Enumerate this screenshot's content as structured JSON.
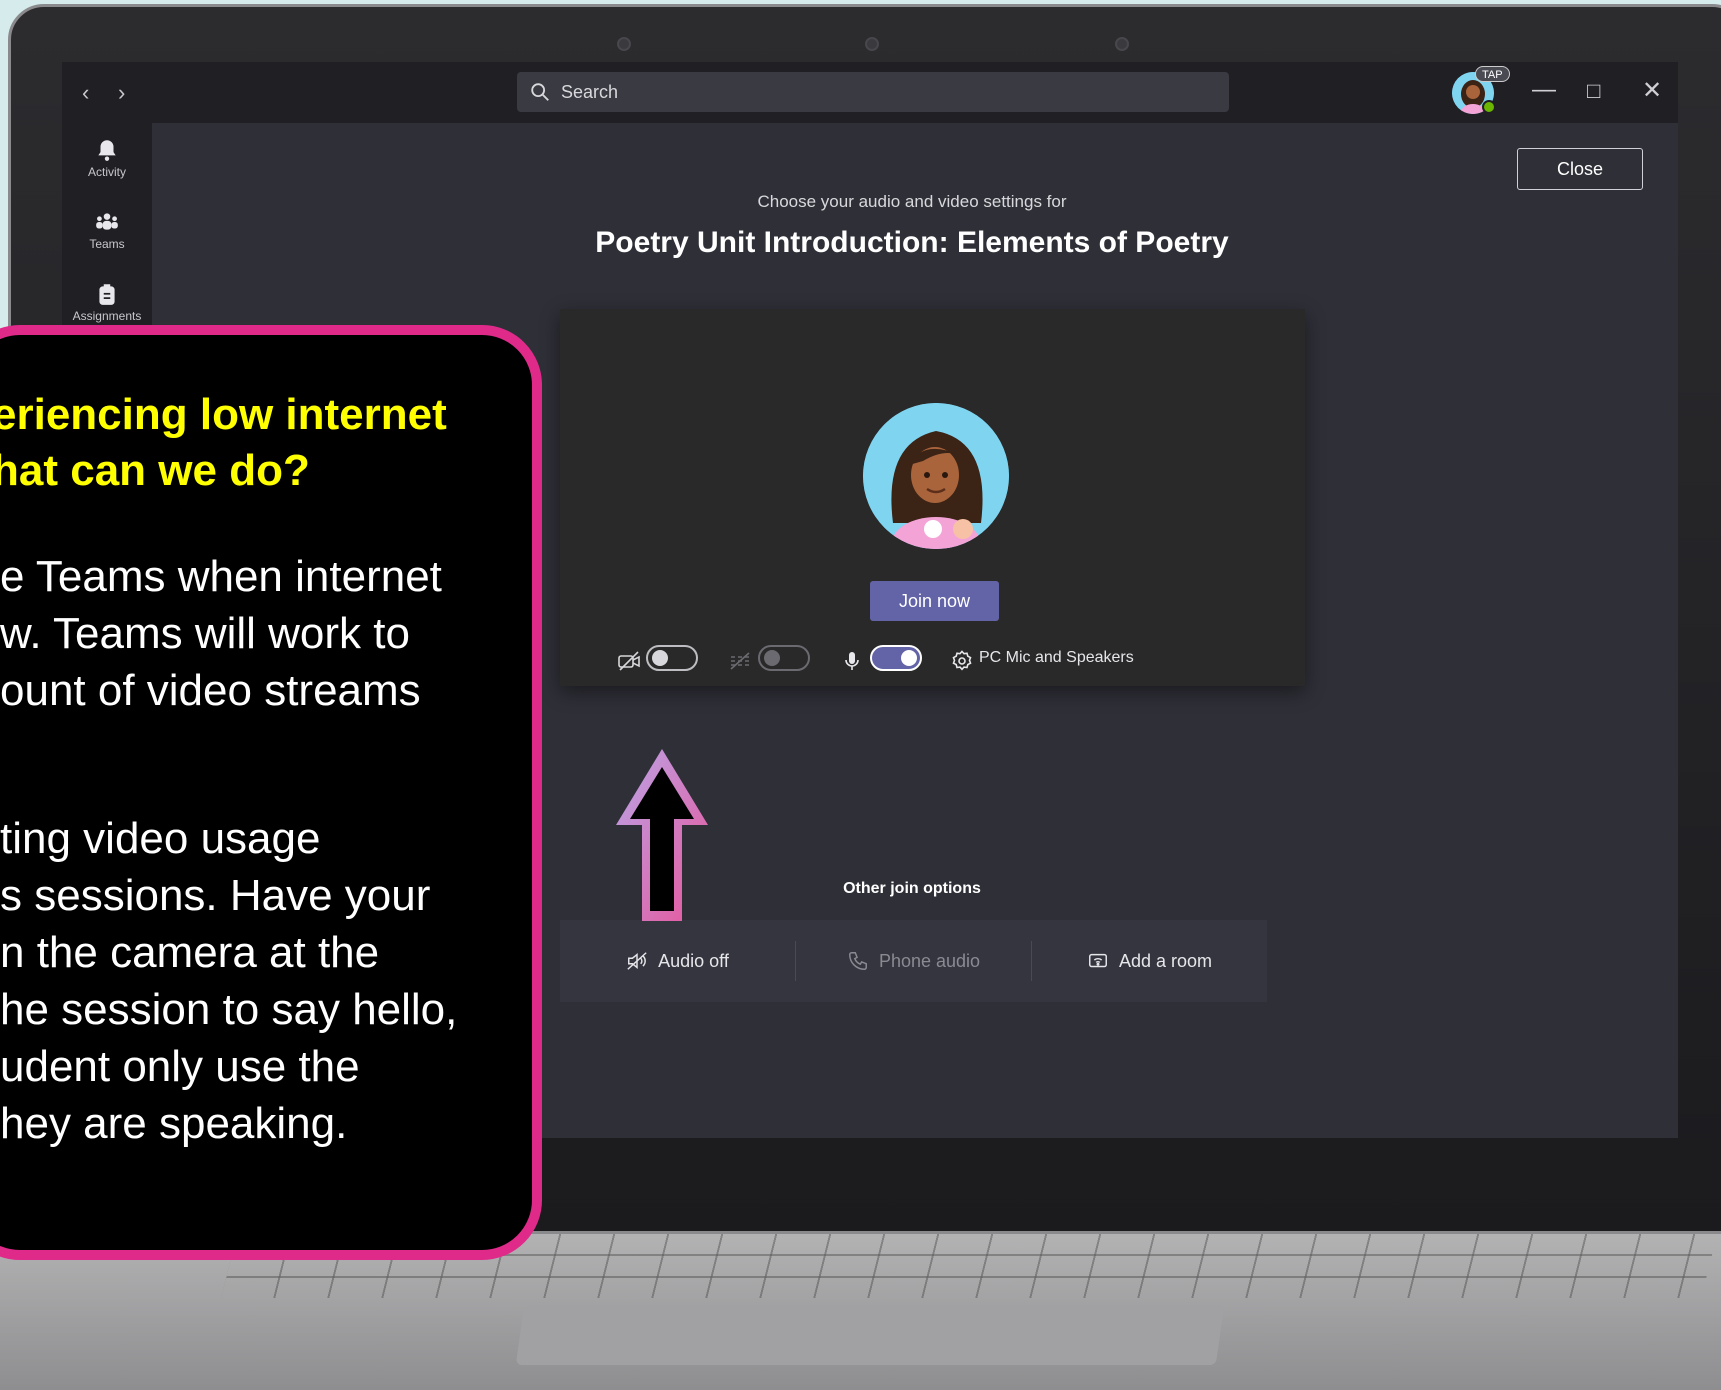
{
  "titlebar": {
    "search_placeholder": "Search",
    "badge": "TAP"
  },
  "app_rail": {
    "items": [
      {
        "label": "Activity",
        "icon": "bell-icon"
      },
      {
        "label": "Teams",
        "icon": "teams-icon"
      },
      {
        "label": "Assignments",
        "icon": "assignments-icon"
      }
    ]
  },
  "prejoin": {
    "close_label": "Close",
    "subtitle": "Choose your audio and video settings for",
    "meeting_title": "Poetry Unit Introduction: Elements of Poetry",
    "join_label": "Join now",
    "device_label": "PC Mic and Speakers",
    "camera_on": false,
    "background_blur_on": false,
    "mic_on": true,
    "other_options_label": "Other join options",
    "other_options": [
      {
        "label": "Audio off",
        "icon": "speaker-off-icon"
      },
      {
        "label": "Phone audio",
        "icon": "phone-icon"
      },
      {
        "label": "Add a room",
        "icon": "room-icon"
      }
    ]
  },
  "callout": {
    "heading_line1": "eriencing low internet",
    "heading_line2": "hat can we do?",
    "para1": [
      "e Teams when internet",
      "w. Teams will work to",
      "ount of video streams"
    ],
    "para2": [
      "ting video usage",
      "s sessions. Have your",
      "n the camera at the",
      "he session to say hello,",
      "udent only use the",
      "hey are speaking."
    ]
  },
  "colors": {
    "accent": "#6264a7",
    "callout_border": "#e02a8a",
    "callout_heading": "#ffff00"
  }
}
